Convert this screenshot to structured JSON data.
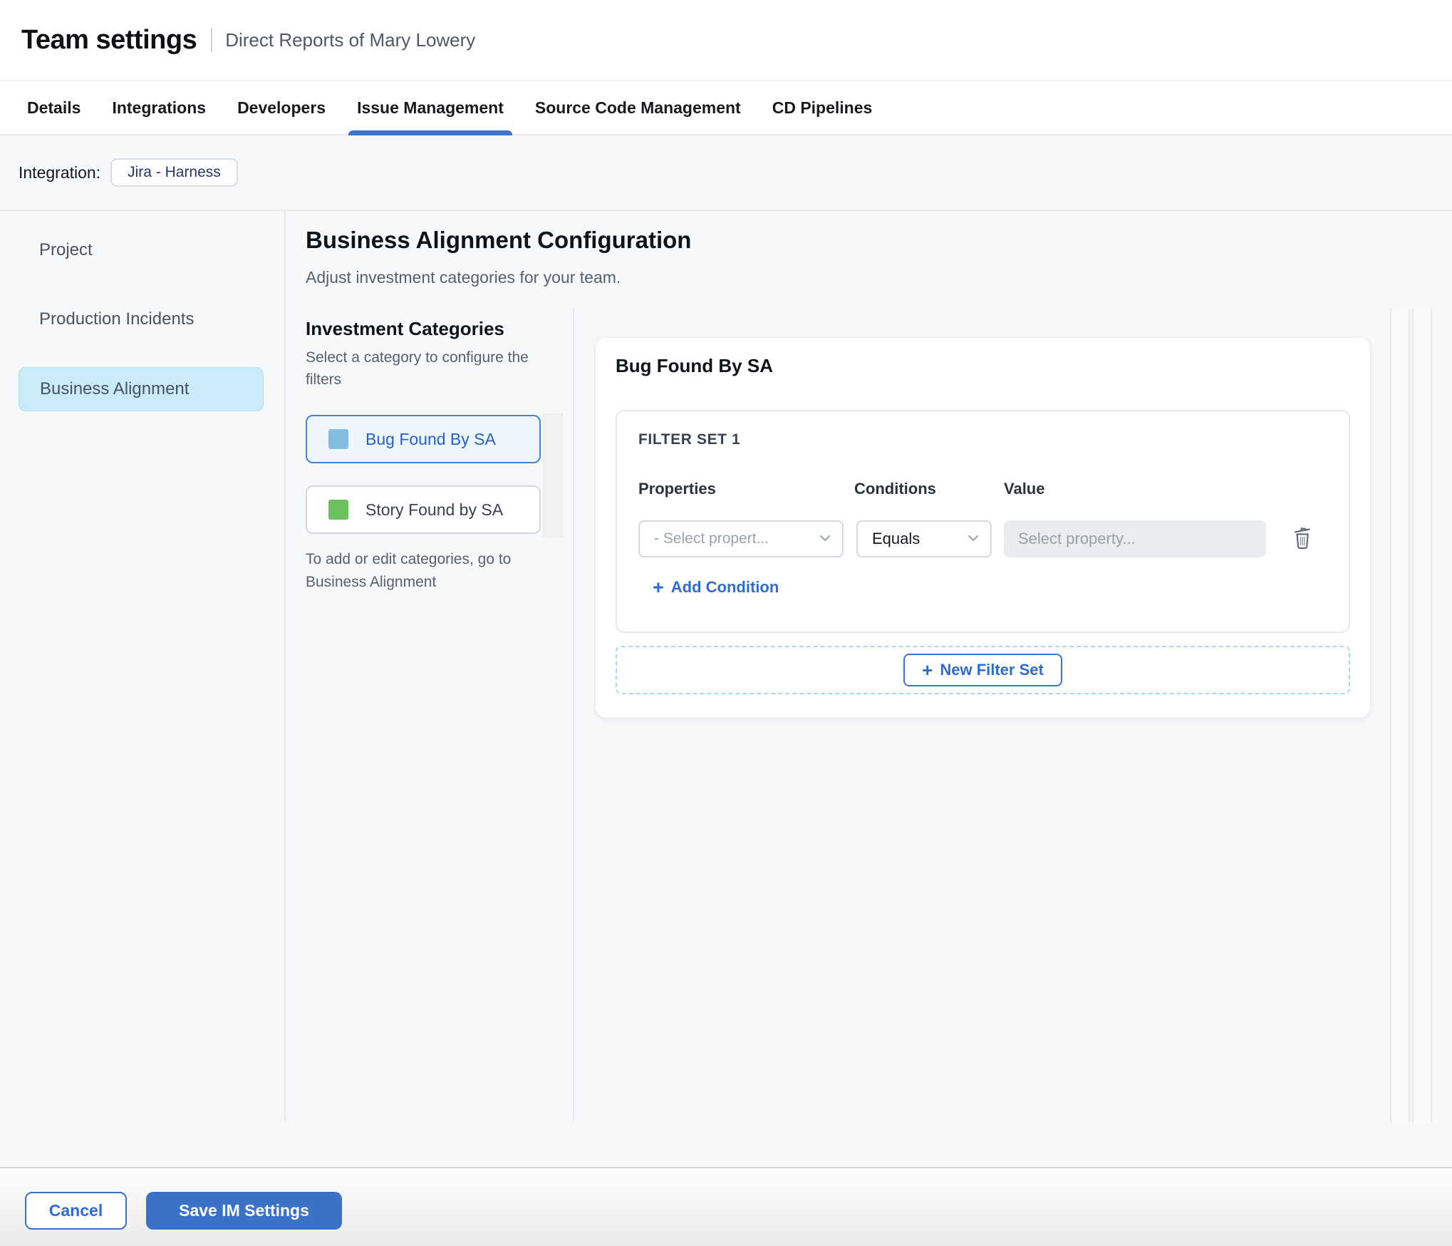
{
  "header": {
    "title": "Team settings",
    "subtitle": "Direct Reports of Mary Lowery"
  },
  "tabs": {
    "items": [
      {
        "label": "Details",
        "active": false
      },
      {
        "label": "Integrations",
        "active": false
      },
      {
        "label": "Developers",
        "active": false
      },
      {
        "label": "Issue Management",
        "active": true
      },
      {
        "label": "Source Code Management",
        "active": false
      },
      {
        "label": "CD Pipelines",
        "active": false
      }
    ]
  },
  "integration_bar": {
    "label": "Integration:",
    "chip": "Jira - Harness"
  },
  "sidebar": {
    "items": [
      {
        "label": "Project",
        "active": false
      },
      {
        "label": "Production Incidents",
        "active": false
      },
      {
        "label": "Business Alignment",
        "active": true
      }
    ]
  },
  "main": {
    "title": "Business Alignment Configuration",
    "subtitle": "Adjust investment categories for your team.",
    "categories": {
      "title": "Investment Categories",
      "description_line1": "Select a category to configure the",
      "description_line2": "filters",
      "items": [
        {
          "label": "Bug Found By SA",
          "swatch_color": "#85bdde",
          "active": true
        },
        {
          "label": "Story Found by SA",
          "swatch_color": "#6cc05e",
          "active": false
        }
      ],
      "footnote_line1": "To add or edit categories, go to",
      "footnote_line2": "Business Alignment"
    },
    "panel": {
      "title": "Bug Found By SA",
      "filter_set": {
        "label": "FILTER SET 1",
        "column_headers": [
          "Properties",
          "Conditions",
          "Value"
        ],
        "property_placeholder": "- Select propert...",
        "condition_selected": "Equals",
        "value_placeholder": "Select property...",
        "add_condition_label": "Add Condition"
      },
      "new_filter_set_label": "New Filter Set"
    }
  },
  "footer": {
    "cancel_label": "Cancel",
    "save_label": "Save IM Settings"
  },
  "icons": {
    "add_plus_glyph": "+",
    "delete": "trash-icon",
    "dropdown": "chevron-down-icon"
  },
  "colors": {
    "accent_blue": "#3a72c8",
    "link_blue": "#2e6cd2",
    "active_tab_underline": "#3c73d0",
    "sidebar_active_bg": "#c9ecf8",
    "category_blue_swatch": "#85bdde",
    "category_green_swatch": "#6cc05e",
    "page_background": "#f7f8fa",
    "value_input_bg": "#e9edf0"
  }
}
